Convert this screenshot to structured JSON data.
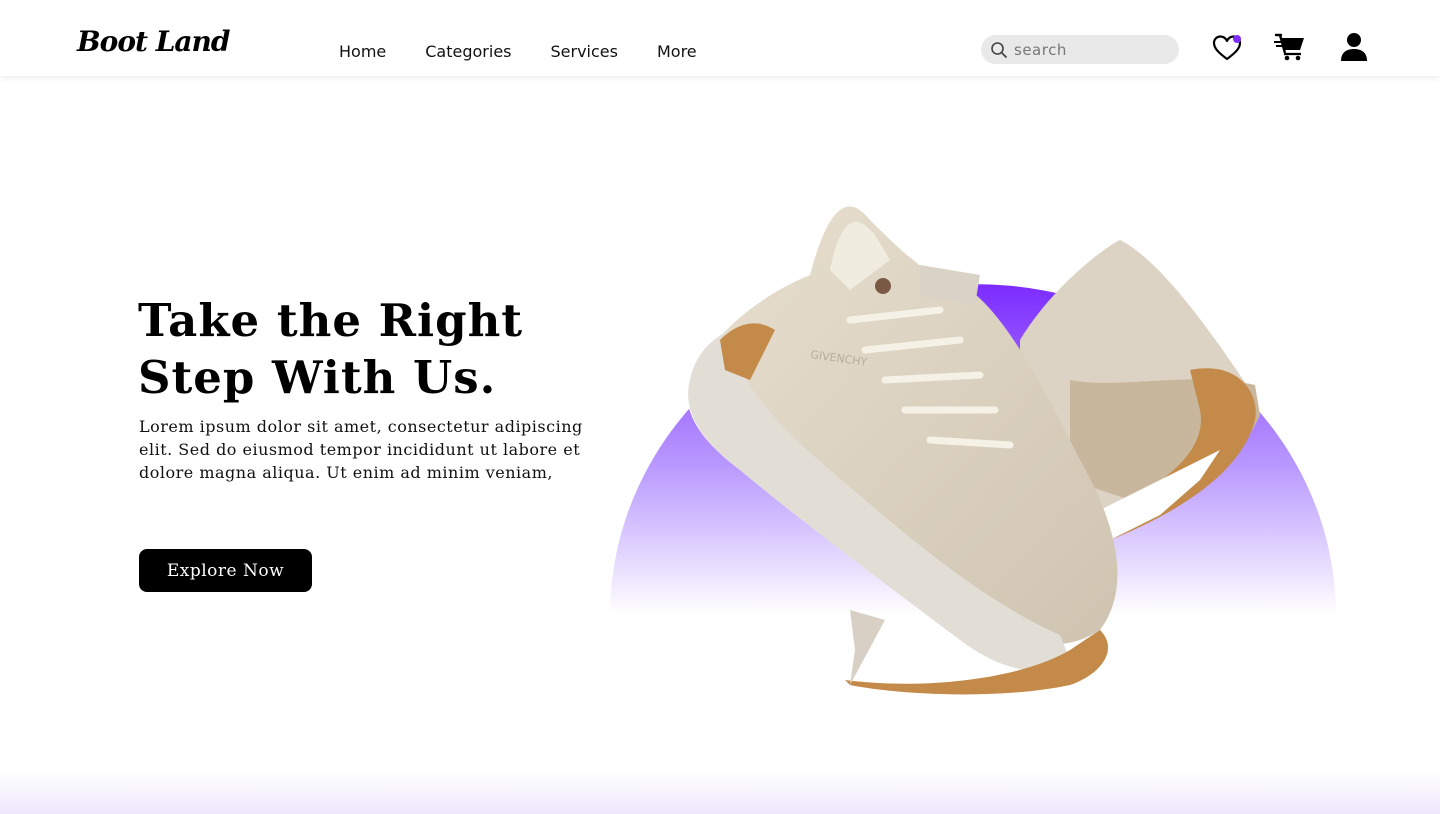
{
  "brand": {
    "logo": "Boot Land"
  },
  "nav": {
    "links": [
      {
        "label": "Home"
      },
      {
        "label": "Categories"
      },
      {
        "label": "Services"
      },
      {
        "label": "More"
      }
    ]
  },
  "search": {
    "placeholder": "search",
    "value": ""
  },
  "icons": {
    "search": "search-icon",
    "wishlist": "heart-icon",
    "cart": "cart-icon",
    "account": "user-icon"
  },
  "hero": {
    "title_line1": "Take the Right",
    "title_line2": "Step With Us.",
    "description": "Lorem ipsum dolor sit amet, consectetur adipiscing elit. Sed do eiusmod tempor incididunt ut labore et dolore magna aliqua. Ut enim ad minim veniam,",
    "cta_label": "Explore Now",
    "product_lettering": "GIVENCHY"
  },
  "colors": {
    "accent": "#7c2cff",
    "button_bg": "#000000",
    "search_bg": "#e9e9e9"
  }
}
